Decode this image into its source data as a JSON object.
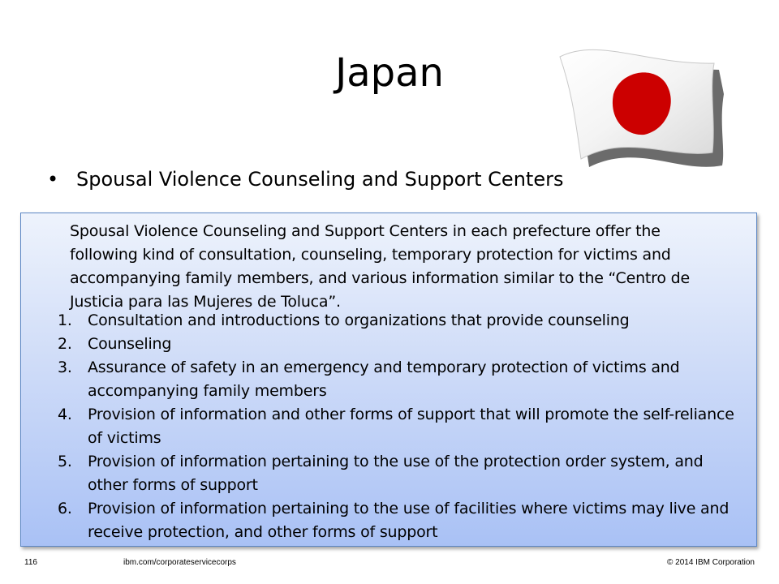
{
  "slide": {
    "title": "Japan",
    "bullet": "Spousal Violence Counseling and Support Centers",
    "bullet_symbol": "•",
    "box_intro": "Spousal Violence Counseling and Support Centers in each prefecture offer the following kind of consultation, counseling, temporary protection for victims and accompanying family members, and various information similar to the “Centro de Justicia para las Mujeres de Toluca”.",
    "list_items": [
      {
        "num": "1.",
        "text": "Consultation and introductions to organizations that provide counseling"
      },
      {
        "num": "2.",
        "text": "Counseling"
      },
      {
        "num": "3.",
        "text": "Assurance of safety in an emergency and temporary protection of victims and accompanying family members"
      },
      {
        "num": "4.",
        "text": "Provision of information and other forms of support that will promote the self-reliance of victims"
      },
      {
        "num": "5.",
        "text": "Provision of information pertaining to the use of the protection order system, and other forms of support"
      },
      {
        "num": "6.",
        "text": "Provision of information pertaining to the use of facilities where victims may live and receive protection, and other forms of support"
      }
    ]
  },
  "flag": {
    "icon": "japan-flag-icon",
    "field_color": "#ffffff",
    "disc_color": "#cc0000"
  },
  "colors": {
    "box_top": "#eef3fc",
    "box_bottom": "#a9c1f5",
    "box_border": "#5b86c4"
  },
  "footer": {
    "page_number": "116",
    "url": "ibm.com/corporateservicecorps",
    "copyright": "© 2014 IBM  Corporation"
  }
}
